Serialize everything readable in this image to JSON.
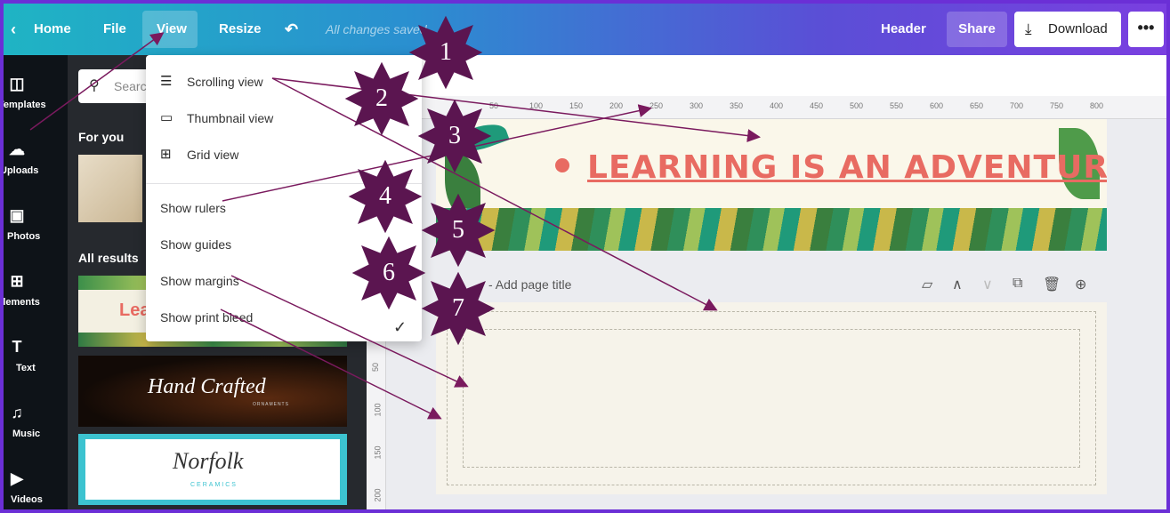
{
  "topbar": {
    "home": "Home",
    "file": "File",
    "view": "View",
    "resize": "Resize",
    "undo_icon": "undo-icon",
    "autosave": "All changes saved",
    "header": "Header",
    "share": "Share",
    "download": "Download",
    "more": "•••"
  },
  "rail": {
    "items": [
      {
        "label": "Templates",
        "icon": "templates-icon"
      },
      {
        "label": "Uploads",
        "icon": "upload-icon"
      },
      {
        "label": "Photos",
        "icon": "photos-icon"
      },
      {
        "label": "Elements",
        "icon": "elements-icon"
      },
      {
        "label": "Text",
        "icon": "text-icon"
      },
      {
        "label": "Music",
        "icon": "music-icon"
      },
      {
        "label": "Videos",
        "icon": "videos-icon"
      }
    ]
  },
  "panel": {
    "search_placeholder": "Search",
    "for_you": "For you",
    "all_results": "All results",
    "thumb_lea": "Lea",
    "thumb_handcrafted": "Hand Crafted",
    "thumb_handcrafted_sub": "ORNAMENTS",
    "thumb_norfolk": "Norfolk",
    "thumb_norfolk_sub": "CERAMICS"
  },
  "menu": {
    "items": [
      {
        "label": "Scrolling view",
        "icon": "scrolling-view-icon"
      },
      {
        "label": "Thumbnail view",
        "icon": "thumbnail-view-icon"
      },
      {
        "label": "Grid view",
        "icon": "grid-view-icon"
      },
      {
        "label": "Show rulers"
      },
      {
        "label": "Show guides"
      },
      {
        "label": "Show margins"
      },
      {
        "label": "Show print bleed",
        "checked": true
      }
    ]
  },
  "ruler": {
    "top": [
      "50",
      "100",
      "150",
      "200",
      "250",
      "300",
      "350",
      "400",
      "450",
      "500",
      "550",
      "600",
      "650",
      "700",
      "750",
      "800"
    ],
    "left": [
      "50",
      "100",
      "150",
      "200"
    ]
  },
  "canvas": {
    "headline": "LEARNING IS AN ADVENTURE.",
    "page2_title": "- Add page title"
  },
  "annotations": [
    "1",
    "2",
    "3",
    "4",
    "5",
    "6",
    "7"
  ],
  "colors": {
    "accent": "#e86b62",
    "badge": "#5b1550",
    "arrow": "#7a1a5e"
  }
}
